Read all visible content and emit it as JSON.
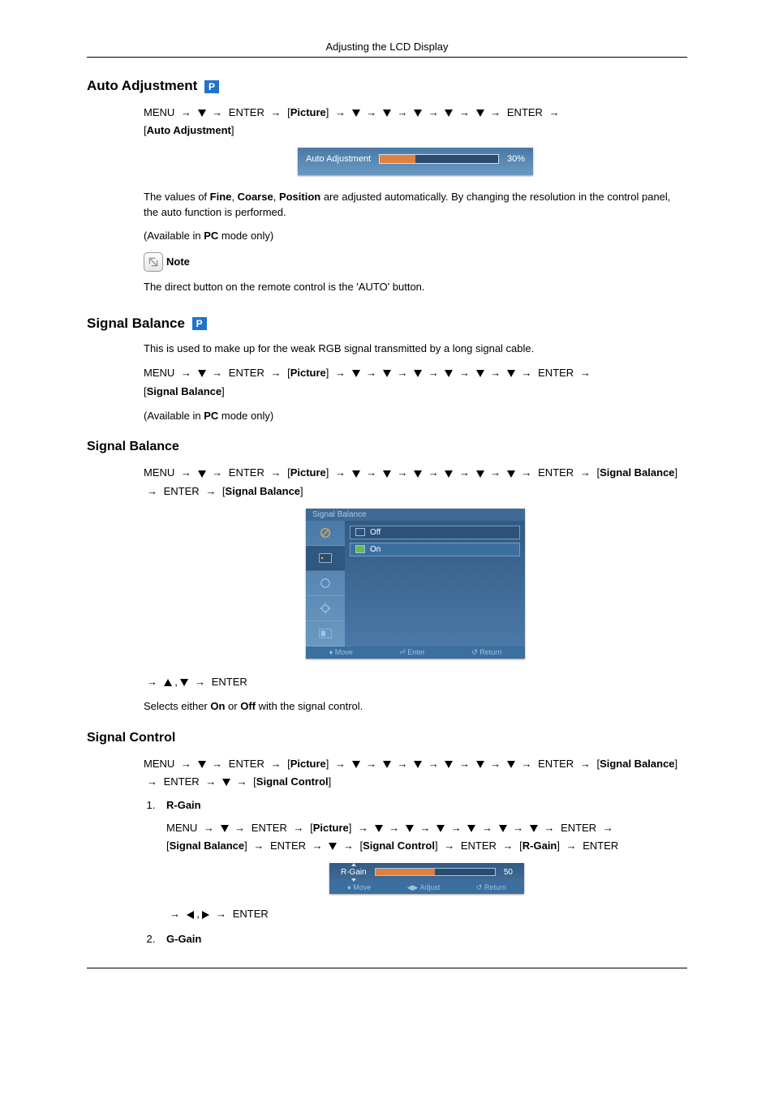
{
  "header": {
    "title": "Adjusting the LCD Display"
  },
  "labels": {
    "menu": "MENU",
    "enter": "ENTER",
    "picture": "Picture",
    "arrow": "→"
  },
  "autoAdjustment": {
    "heading": "Auto Adjustment",
    "breadTarget": "Auto Adjustment",
    "osd": {
      "label": "Auto Adjustment",
      "percent": "30%"
    },
    "line1a": "The values of ",
    "line1b_fine": "Fine",
    "line1b_sep": ", ",
    "line1b_coarse": "Coarse",
    "line1b_sep2": ", ",
    "line1b_position": "Position",
    "line1c": " are adjusted automatically. By changing the resolution in the control panel, the auto function is performed.",
    "avail_a": "(Available in ",
    "avail_pc": "PC",
    "avail_b": " mode only)",
    "note_label": "Note",
    "note_text": "The direct button on the remote control is the 'AUTO' button."
  },
  "signalBalance": {
    "heading": "Signal Balance",
    "intro": "This is used to make up for the weak RGB signal transmitted by a long signal cable.",
    "breadTarget": "Signal Balance",
    "avail_a": "(Available in ",
    "avail_pc": "PC",
    "avail_b": " mode only)"
  },
  "signalBalanceSub": {
    "heading": "Signal Balance",
    "breadEnd1": "Signal Balance",
    "breadEnd2": "Signal Balance",
    "osd": {
      "title": "Signal Balance",
      "off": "Off",
      "on": "On",
      "hint_move": "Move",
      "hint_enter": "Enter",
      "hint_return": "Return"
    },
    "selects_a": "Selects either ",
    "on": "On",
    "or": " or ",
    "off": "Off",
    "selects_b": " with the signal control."
  },
  "signalControl": {
    "heading": "Signal Control",
    "breadEnd1": "Signal Balance",
    "breadEnd2": "Signal Control",
    "items": {
      "rGain": {
        "title": "R-Gain",
        "b_signalBalance": "Signal Balance",
        "b_signalControl": "Signal Control",
        "b_rGain": "R-Gain",
        "osd": {
          "label": "R-Gain",
          "value": "50",
          "hint_move": "Move",
          "hint_adjust": "Adjust",
          "hint_return": "Return"
        }
      },
      "gGain": {
        "title": "G-Gain"
      }
    }
  }
}
